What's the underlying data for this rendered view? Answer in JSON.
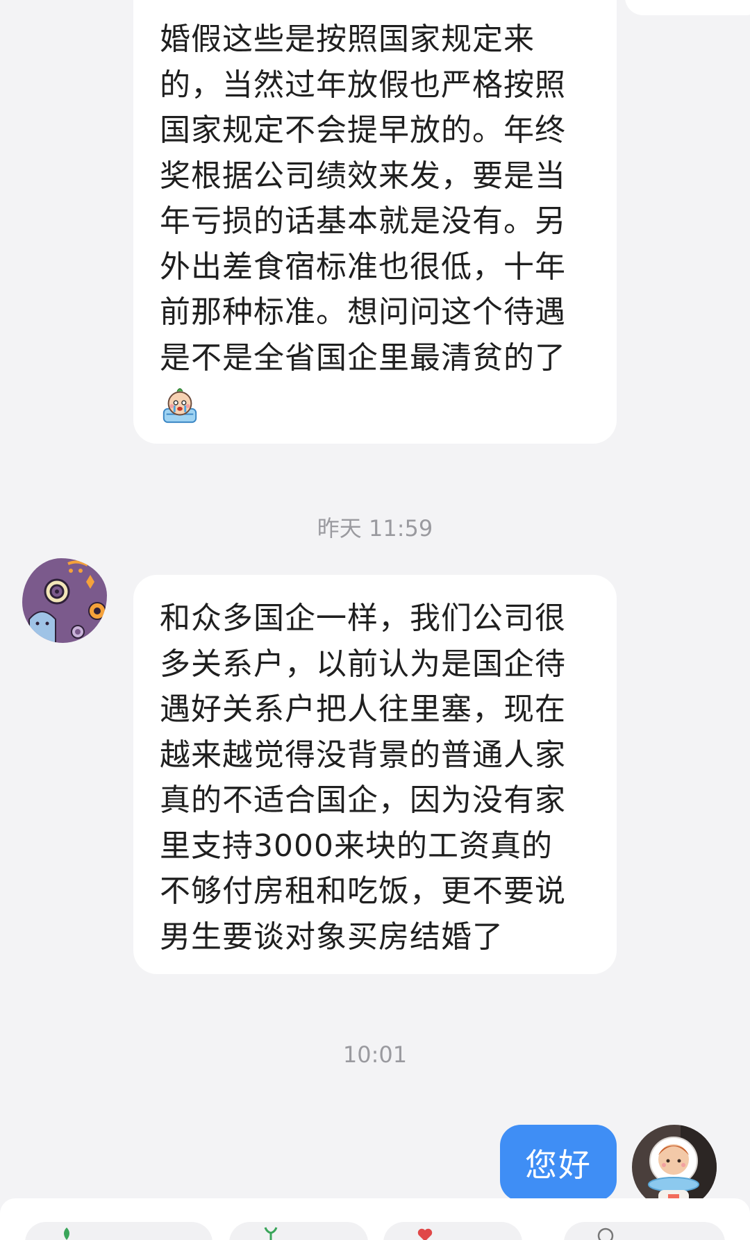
{
  "messages": {
    "first_text": "婚假这些是按照国家规定来\n的，当然过年放假也严格按照\n国家规定不会提早放的。年终\n奖根据公司绩效来发，要是当\n年亏损的话基本就是没有。另\n外出差食宿标准也很低，十年\n前那种标准。想问问这个待遇\n是不是全省国企里最清贫的了",
    "first_emoji_icon": "crying-cartoon-emoji-icon",
    "timestamp_1": "昨天 11:59",
    "second_text": "和众多国企一样，我们公司很\n多关系户，以前认为是国企待\n遇好关系户把人往里塞，现在\n越来越觉得没背景的普通人家\n真的不适合国企，因为没有家\n里支持3000来块的工资真的\n不够付房租和吃饭，更不要说\n男生要谈对象买房结婚了",
    "timestamp_2": "10:01",
    "sent_text": "您好"
  },
  "avatars": {
    "left_icon": "purple-pattern-avatar",
    "right_icon": "astronaut-figure-avatar"
  },
  "colors": {
    "background": "#f3f3f5",
    "bubble_received": "#ffffff",
    "bubble_sent": "#3f8ef5",
    "text_primary": "#1f1f1f",
    "timestamp": "#9a9a9f"
  }
}
